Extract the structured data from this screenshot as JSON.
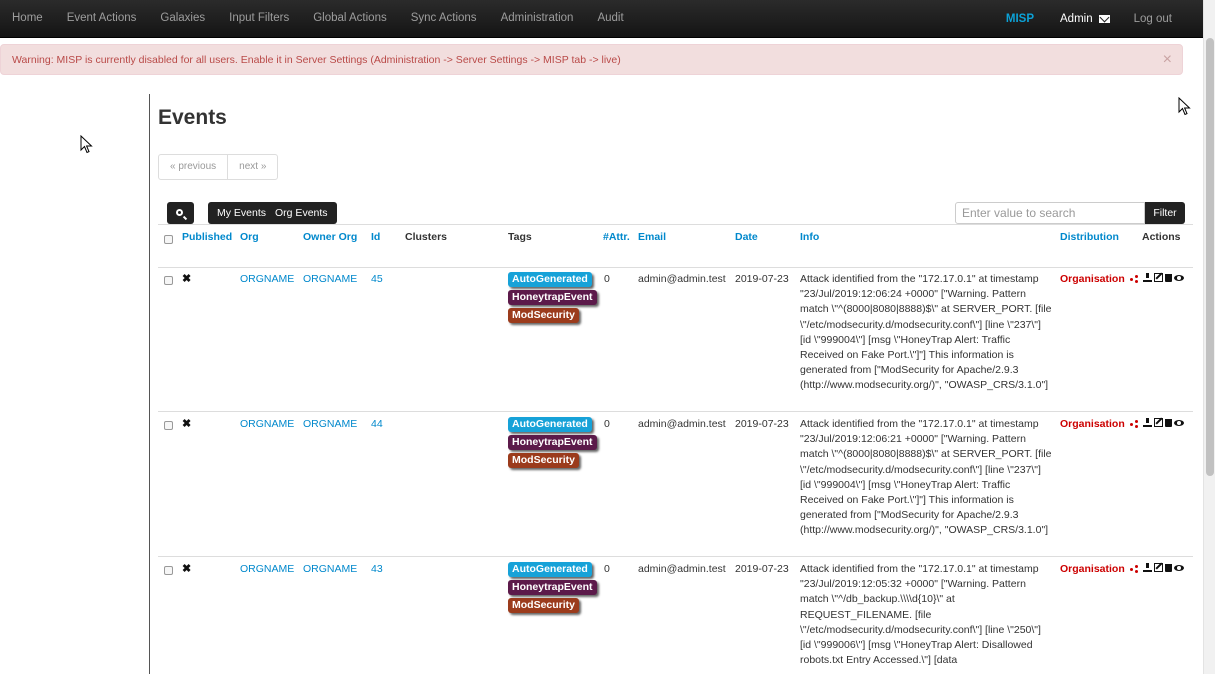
{
  "nav": {
    "items": [
      "Home",
      "Event Actions",
      "Galaxies",
      "Input Filters",
      "Global Actions",
      "Sync Actions",
      "Administration",
      "Audit"
    ],
    "brand": "MISP",
    "user": "Admin",
    "logout": "Log out"
  },
  "alert": {
    "text": "Warning: MISP is currently disabled for all users. Enable it in Server Settings (Administration -> Server Settings -> MISP tab -> live)",
    "close": "×"
  },
  "page": {
    "title": "Events",
    "prev": "« previous",
    "next": "next »"
  },
  "toolbar": {
    "my_events": "My Events",
    "org_events": "Org Events",
    "search_placeholder": "Enter value to search",
    "filter": "Filter"
  },
  "table": {
    "headers": {
      "published": "Published",
      "org": "Org",
      "owner_org": "Owner Org",
      "id": "Id",
      "clusters": "Clusters",
      "tags": "Tags",
      "attr": "#Attr.",
      "email": "Email",
      "date": "Date",
      "info": "Info",
      "distribution": "Distribution",
      "actions": "Actions"
    },
    "rows": [
      {
        "published": "✖",
        "org": "ORGNAME",
        "owner_org": "ORGNAME",
        "id": "45",
        "tags": [
          "AutoGenerated",
          "HoneytrapEvent",
          "ModSecurity"
        ],
        "attr": "0",
        "email": "admin@admin.test",
        "date": "2019-07-23",
        "info": "Attack identified from the \"172.17.0.1\" at timestamp \"23/Jul/2019:12:06:24 +0000\" [\"Warning. Pattern match \\\"^(8000|8080|8888)$\\\" at SERVER_PORT. [file \\\"/etc/modsecurity.d/modsecurity.conf\\\"] [line \\\"237\\\"] [id \\\"999004\\\"] [msg \\\"HoneyTrap Alert: Traffic Received on Fake Port.\\\"]\"] This information is generated from [\"ModSecurity for Apache/2.9.3 (http://www.modsecurity.org/)\", \"OWASP_CRS/3.1.0\"]",
        "distribution": "Organisation"
      },
      {
        "published": "✖",
        "org": "ORGNAME",
        "owner_org": "ORGNAME",
        "id": "44",
        "tags": [
          "AutoGenerated",
          "HoneytrapEvent",
          "ModSecurity"
        ],
        "attr": "0",
        "email": "admin@admin.test",
        "date": "2019-07-23",
        "info": "Attack identified from the \"172.17.0.1\" at timestamp \"23/Jul/2019:12:06:21 +0000\" [\"Warning. Pattern match \\\"^(8000|8080|8888)$\\\" at SERVER_PORT. [file \\\"/etc/modsecurity.d/modsecurity.conf\\\"] [line \\\"237\\\"] [id \\\"999004\\\"] [msg \\\"HoneyTrap Alert: Traffic Received on Fake Port.\\\"]\"] This information is generated from [\"ModSecurity for Apache/2.9.3 (http://www.modsecurity.org/)\", \"OWASP_CRS/3.1.0\"]",
        "distribution": "Organisation"
      },
      {
        "published": "✖",
        "org": "ORGNAME",
        "owner_org": "ORGNAME",
        "id": "43",
        "tags": [
          "AutoGenerated",
          "HoneytrapEvent",
          "ModSecurity"
        ],
        "attr": "0",
        "email": "admin@admin.test",
        "date": "2019-07-23",
        "info": "Attack identified from the \"172.17.0.1\" at timestamp \"23/Jul/2019:12:05:32 +0000\" [\"Warning. Pattern match \\\"^/db_backup.\\\\\\\\d{10}\\\" at REQUEST_FILENAME. [file \\\"/etc/modsecurity.d/modsecurity.conf\\\"] [line \\\"250\\\"] [id \\\"999006\\\"] [msg \\\"HoneyTrap Alert: Disallowed robots.txt Entry Accessed.\\\"] [data",
        "distribution": "Organisation"
      }
    ]
  },
  "colors": {
    "tag_autogenerated": "#17a2d8",
    "tag_honeytrap": "#5c1a4a",
    "tag_modsecurity": "#9b3b1c",
    "link": "#0088cc",
    "distribution": "#cc0000"
  },
  "icons": [
    "search-icon",
    "mail-icon",
    "share-icon",
    "download-icon",
    "edit-icon",
    "delete-icon",
    "view-icon"
  ]
}
